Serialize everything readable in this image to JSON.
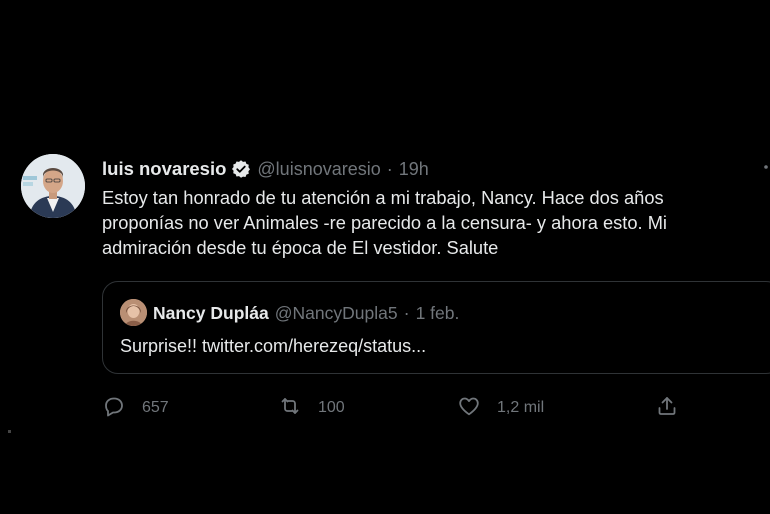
{
  "tweet": {
    "author_name": "luis novaresio",
    "author_handle": "@luisnovaresio",
    "separator": "·",
    "time": "19h",
    "more": "…",
    "body_lines": [
      "Estoy tan honrado de tu atención a mi trabajo, Nancy.  Hace dos años",
      "proponías no ver Animales -re parecido a la censura- y ahora esto.  Mi",
      "admiración desde tu época de El vestidor.   Salute"
    ]
  },
  "quote": {
    "author_name": "Nancy Dupláa",
    "author_handle": "@NancyDupla5",
    "separator": "·",
    "time": "1 feb.",
    "text": "Surprise!! twitter.com/herezeq/status..."
  },
  "actions": {
    "reply_count": "657",
    "retweet_count": "100",
    "like_count": "1,2 mil"
  },
  "colors": {
    "background": "#000000",
    "text": "#e7e9ea",
    "secondary": "#71767b",
    "verified": "#1d9bf0",
    "border": "#2f3336"
  },
  "icons": {
    "verified": "verified-badge-icon",
    "reply": "reply-bubble-icon",
    "retweet": "retweet-arrows-icon",
    "like": "heart-icon",
    "share": "share-upload-icon",
    "more": "more-dots-icon"
  }
}
